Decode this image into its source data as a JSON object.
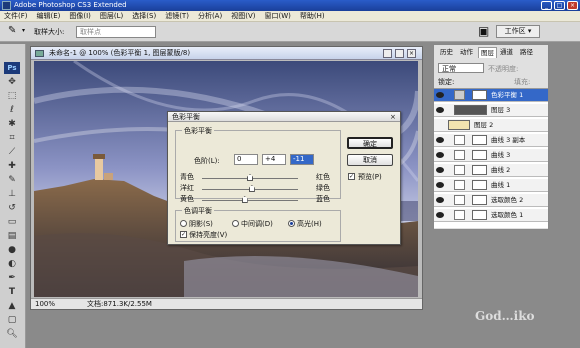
{
  "app": {
    "title": "Adobe Photoshop CS3 Extended",
    "window_buttons": [
      "_",
      "□",
      "×"
    ]
  },
  "menu": [
    "文件(F)",
    "编辑(E)",
    "图像(I)",
    "图层(L)",
    "选择(S)",
    "滤镜(T)",
    "分析(A)",
    "视图(V)",
    "窗口(W)",
    "帮助(H)"
  ],
  "options_bar": {
    "sample_size_label": "取样大小:",
    "sample_size_value": "取样点",
    "workspace_label": "工作区 ▾"
  },
  "document": {
    "title": "未命名-1 @ 100% (色彩平衡 1, 图层蒙版/8)",
    "zoom": "100%",
    "doc_info": "文档:871.3K/2.55M"
  },
  "layers_panel": {
    "tabs": [
      "历史",
      "动作",
      "图层",
      "通道",
      "路径"
    ],
    "active_tab": 2,
    "blend_mode": "正常",
    "opacity_label": "不透明度:",
    "lock_label": "锁定:",
    "fill_label": "填充:",
    "layers": [
      {
        "name": "色彩平衡 1",
        "selected": true
      },
      {
        "name": "图层 3",
        "selected": false
      },
      {
        "name": "图层 2",
        "selected": false
      },
      {
        "name": "曲线 3 副本",
        "selected": false
      },
      {
        "name": "曲线 3",
        "selected": false
      },
      {
        "name": "曲线 2",
        "selected": false
      },
      {
        "name": "曲线 1",
        "selected": false
      },
      {
        "name": "选取颜色 2",
        "selected": false
      },
      {
        "name": "选取颜色 1",
        "selected": false
      }
    ]
  },
  "dialog": {
    "title": "色彩平衡",
    "color_balance_group": "色彩平衡",
    "levels_label": "色阶(L):",
    "levels": [
      "0",
      "+4",
      "-11"
    ],
    "sliders": [
      {
        "left": "青色",
        "right": "红色",
        "value": 0
      },
      {
        "left": "洋红",
        "right": "绿色",
        "value": 4
      },
      {
        "left": "黄色",
        "right": "蓝色",
        "value": -11
      }
    ],
    "tone_group": "色调平衡",
    "tones": [
      {
        "label": "阴影(S)",
        "checked": false
      },
      {
        "label": "中间调(D)",
        "checked": false
      },
      {
        "label": "高光(H)",
        "checked": true
      }
    ],
    "preserve_luminosity": "保持亮度(V)",
    "preserve_checked": true,
    "ok_label": "确定",
    "cancel_label": "取消",
    "preview_label": "预览(P)",
    "preview_checked": true
  },
  "watermark": "God…iko",
  "colors": {
    "titlebar": "#1a3f9a",
    "selected_layer": "#3468c8",
    "background": "#8a8a8a"
  }
}
